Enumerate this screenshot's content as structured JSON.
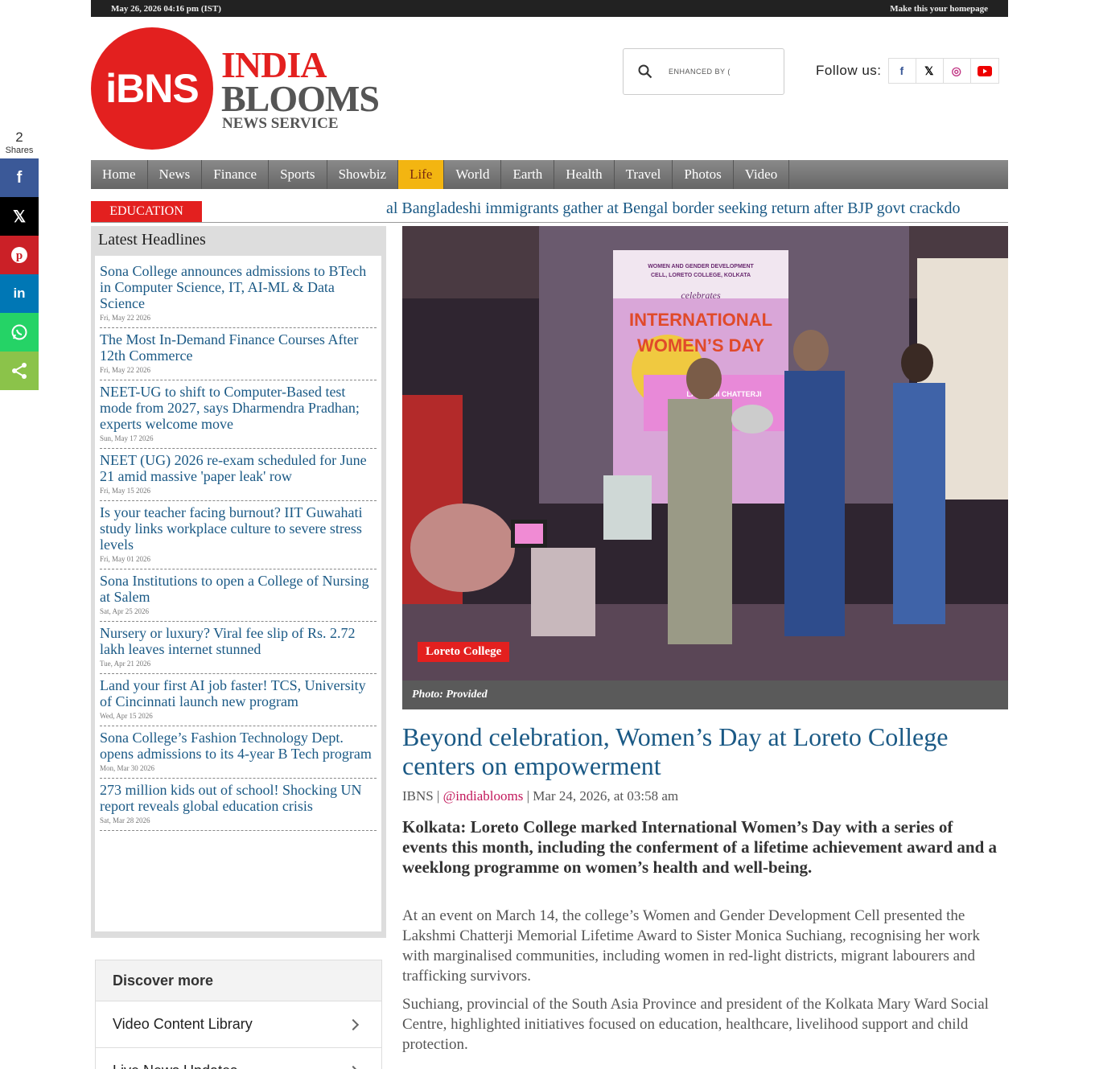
{
  "topbar": {
    "datetime": "May 26, 2026 04:16 pm (IST)",
    "homepage_link": "Make this your homepage"
  },
  "logo": {
    "badge": "iBNS",
    "line1": "INDIA",
    "line2": "BLOOMS",
    "line3": "NEWS SERVICE"
  },
  "search": {
    "enhanced": "ENHANCED BY",
    "cursor": "("
  },
  "follow": {
    "label": "Follow us:",
    "icons": [
      "facebook-icon",
      "x-icon",
      "instagram-icon",
      "youtube-icon"
    ],
    "glyphs": [
      "f",
      "𝕏",
      "◎",
      "▶"
    ]
  },
  "nav": [
    "Home",
    "News",
    "Finance",
    "Sports",
    "Showbiz",
    "Life",
    "World",
    "Earth",
    "Health",
    "Travel",
    "Photos",
    "Video"
  ],
  "category": "EDUCATION",
  "ticker": "gal Bangladeshi immigrants gather at Bengal border seeking return after BJP govt crackdo",
  "share": {
    "count": "2",
    "label": "Shares",
    "buttons": [
      {
        "icon": "facebook-icon",
        "glyph": "f",
        "color": "#3b5998"
      },
      {
        "icon": "x-icon",
        "glyph": "𝕏",
        "color": "#000000"
      },
      {
        "icon": "pinterest-icon",
        "glyph": "P",
        "color": "#cb2027"
      },
      {
        "icon": "linkedin-icon",
        "glyph": "in",
        "color": "#0077b5"
      },
      {
        "icon": "whatsapp-icon",
        "glyph": "✆",
        "color": "#25d366"
      },
      {
        "icon": "share-icon",
        "glyph": "⋖",
        "color": "#8bc34a"
      }
    ]
  },
  "latest": {
    "title": "Latest Headlines",
    "items": [
      {
        "title": "Sona College announces admissions to BTech in Computer Science, IT, AI-ML & Data Science",
        "date": "Fri, May 22 2026"
      },
      {
        "title": "The Most In-Demand Finance Courses After 12th Commerce",
        "date": "Fri, May 22 2026"
      },
      {
        "title": "NEET-UG to shift to Computer-Based test mode from 2027, says Dharmendra Pradhan; experts welcome move",
        "date": "Sun, May 17 2026"
      },
      {
        "title": "NEET (UG) 2026 re-exam scheduled for June 21 amid massive 'paper leak' row",
        "date": "Fri, May 15 2026"
      },
      {
        "title": "Is your teacher facing burnout? IIT Guwahati study links workplace culture to severe stress levels",
        "date": "Fri, May 01 2026"
      },
      {
        "title": "Sona Institutions to open a College of Nursing at Salem",
        "date": "Sat, Apr 25 2026"
      },
      {
        "title": "Nursery or luxury? Viral fee slip of Rs. 2.72 lakh leaves internet stunned",
        "date": "Tue, Apr 21 2026"
      },
      {
        "title": "Land your first AI job faster! TCS, University of Cincinnati launch new program",
        "date": "Wed, Apr 15 2026"
      },
      {
        "title": "Sona College’s Fashion Technology Dept. opens admissions to its 4-year B Tech program",
        "date": "Mon, Mar 30 2026"
      },
      {
        "title": "273 million kids out of school! Shocking UN report reveals global education crisis",
        "date": "Sat, Mar 28 2026"
      }
    ]
  },
  "discover": {
    "title": "Discover more",
    "rows": [
      "Video Content Library",
      "Live News Updates"
    ]
  },
  "article": {
    "photo_tag": "Loreto College",
    "photo_caption": "Photo: Provided",
    "screen_lines": [
      "WOMEN AND GENDER DEVELOPMENT",
      "CELL, LORETO COLLEGE, KOLKATA",
      "celebrates",
      "INTERNATIONAL",
      "WOMEN’S DAY",
      "LAKSHMI CHATTERJI"
    ],
    "headline": "Beyond celebration, Women’s Day at Loreto College centers on empowerment",
    "byline_source": "IBNS",
    "byline_handle": "@indiablooms",
    "byline_date": "Mar 24, 2026, at 03:58 am",
    "lede": "Kolkata: Loreto College marked International Women’s Day with a series of events this month, including the conferment of a lifetime achievement award and a weeklong programme on women’s health and well-being.",
    "paragraphs": [
      "At an event on March 14, the college’s Women and Gender Development Cell presented the Lakshmi Chatterji Memorial Lifetime Award to Sister Monica Suchiang, recognising her work with marginalised communities, including women in red-light districts, migrant labourers and trafficking survivors.",
      "Suchiang, provincial of the South Asia Province and president of the Kolkata Mary Ward Social Centre, highlighted initiatives focused on education, healthcare, livelihood support and child protection."
    ]
  }
}
